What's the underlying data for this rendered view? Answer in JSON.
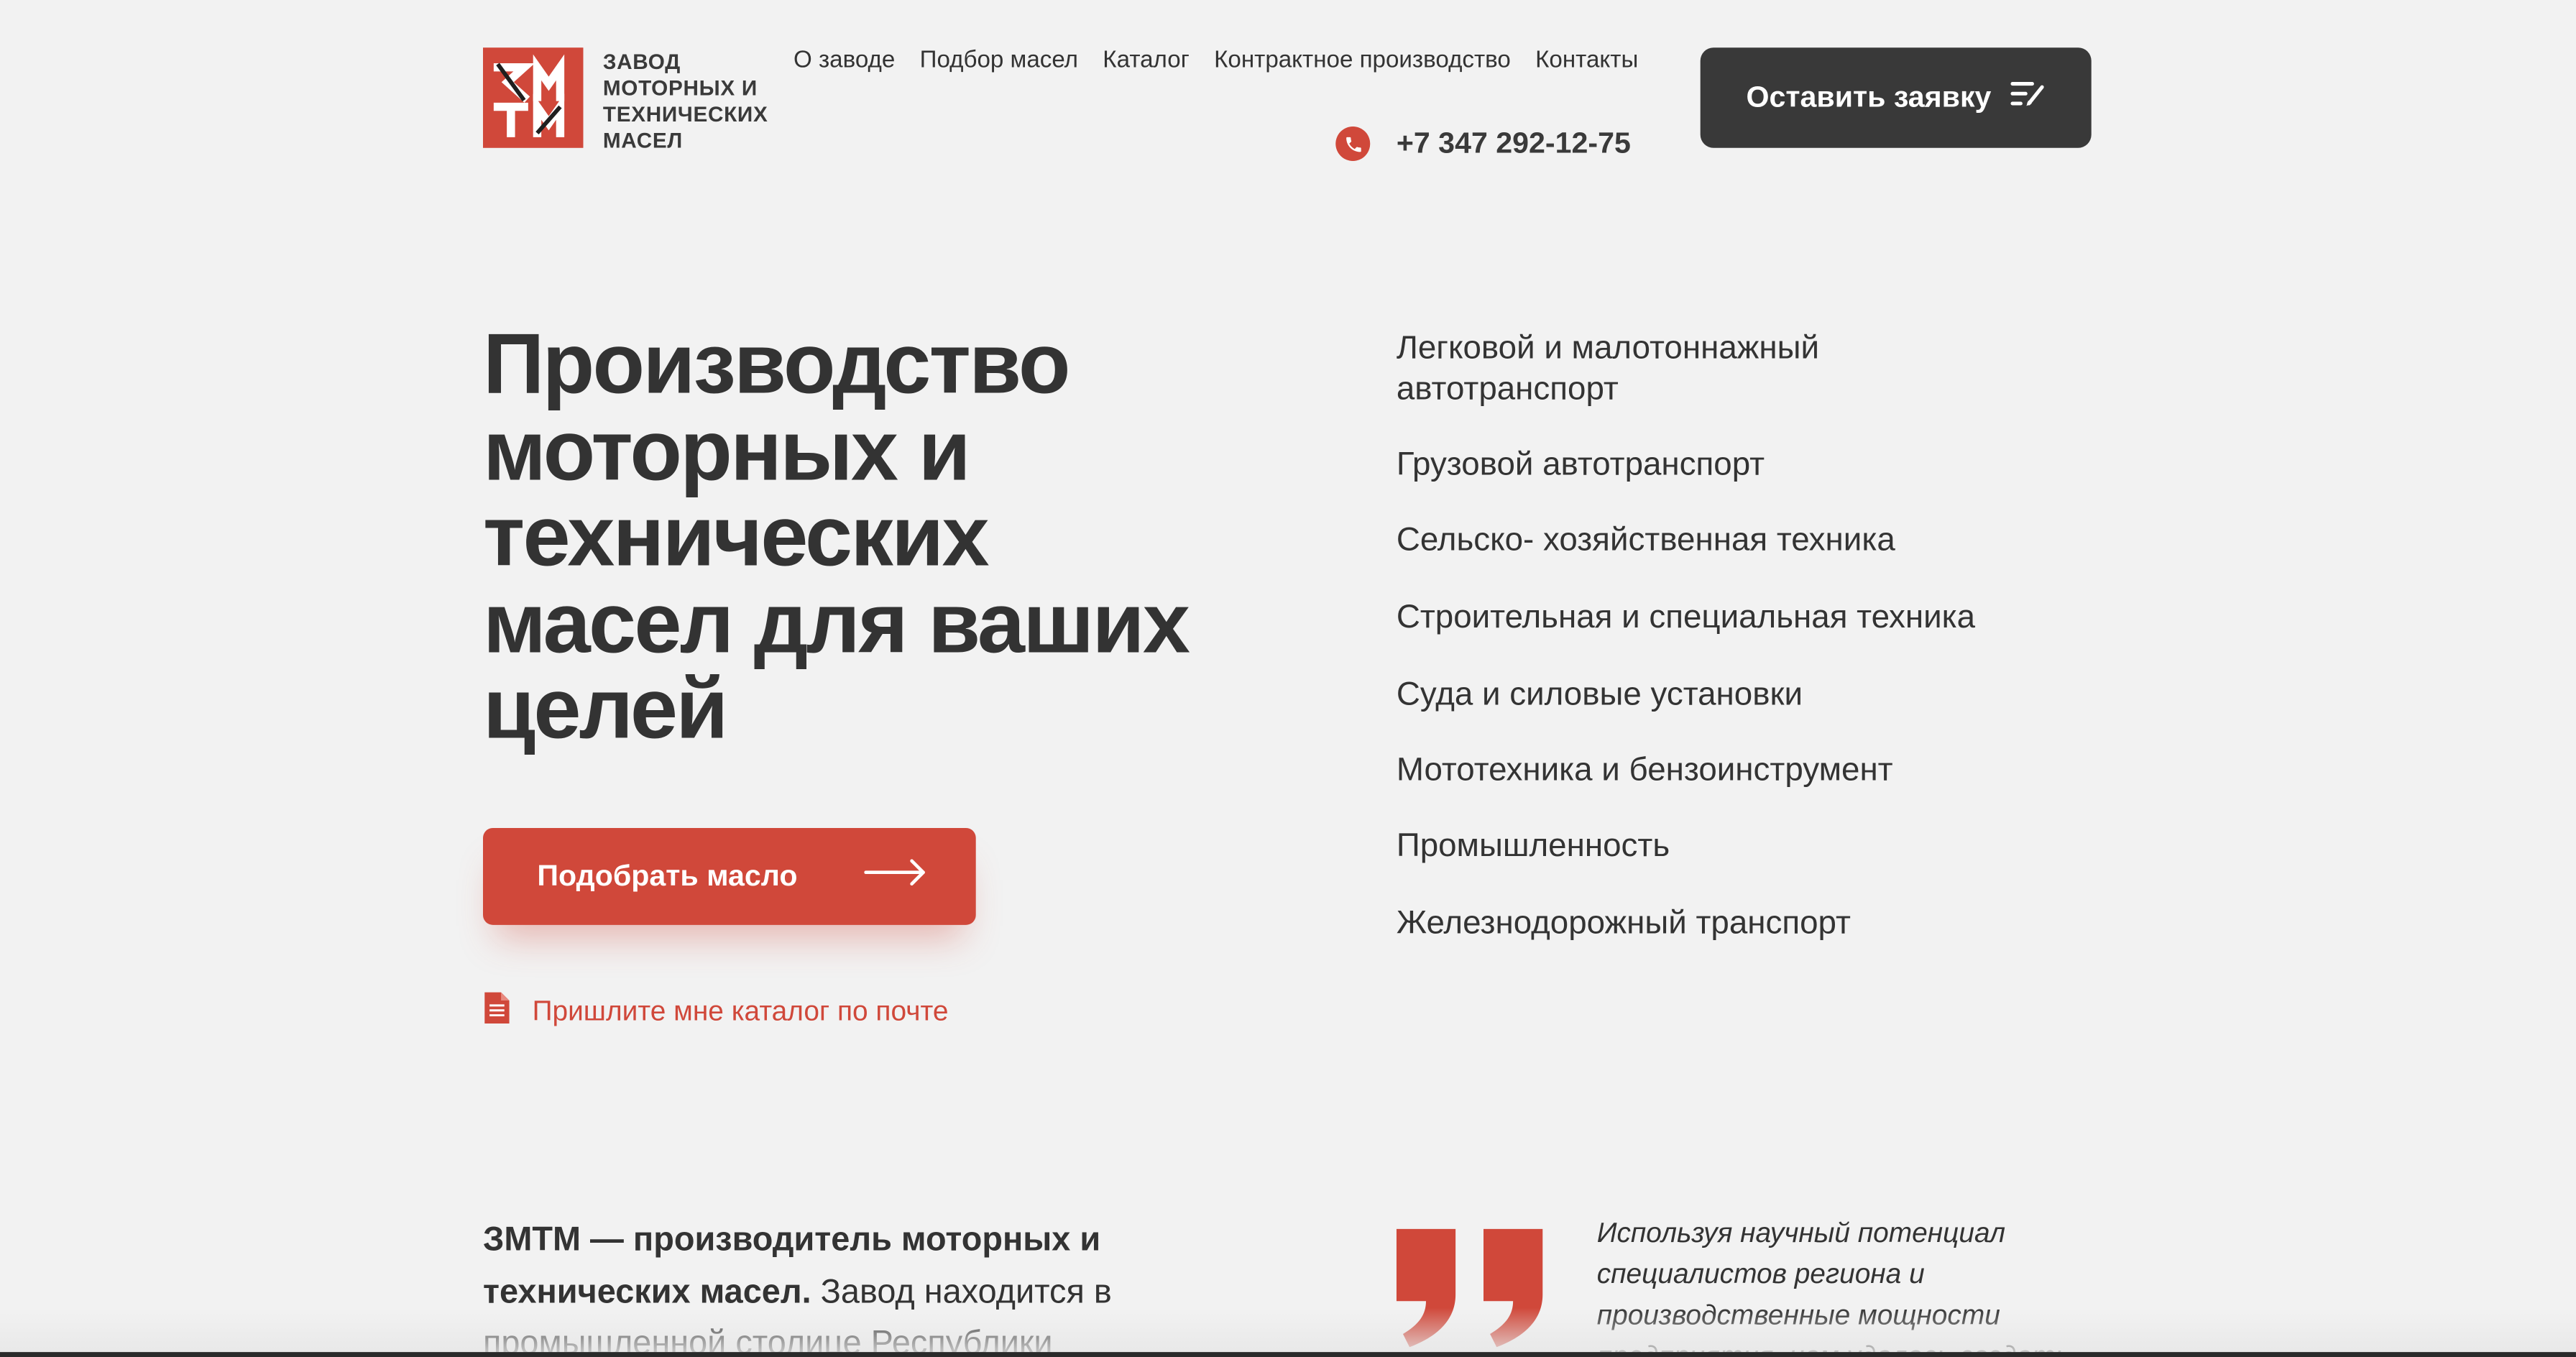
{
  "header": {
    "logo_lines": [
      "ЗАВОД",
      "МОТОРНЫХ И",
      "ТЕХНИЧЕСКИХ",
      "МАСЕЛ"
    ],
    "nav": [
      "О заводе",
      "Подбор масел",
      "Каталог",
      "Контрактное производство",
      "Контакты"
    ],
    "phone": "+7 347 292-12-75",
    "cta_label": "Оставить заявку"
  },
  "hero": {
    "title_lines": [
      "Производство",
      "моторных и",
      "технических",
      "масел для ваших",
      "целей"
    ],
    "pick_button": "Подобрать масло",
    "mail_link": "Пришлите мне каталог по почте",
    "categories": [
      "Легковой и малотоннажный автотранспорт",
      "Грузовой автотранспорт",
      "Сельско- хозяйственная техника",
      "Строительная и специальная техника",
      "Суда и силовые установки",
      "Мототехника и бензоинструмент",
      "Промышленность",
      "Железнодорожный транспорт"
    ]
  },
  "about": {
    "bold": "ЗМТМ — производитель моторных и технических масел.",
    "text": " Завод находится в промышленной столице Республики"
  },
  "quote": {
    "text": "Используя научный потенциал специалистов региона и производственные мощности предприятия, нам удалось создать"
  },
  "colors": {
    "accent": "#d0483a",
    "dark": "#393939",
    "background": "#f2f2f2"
  }
}
